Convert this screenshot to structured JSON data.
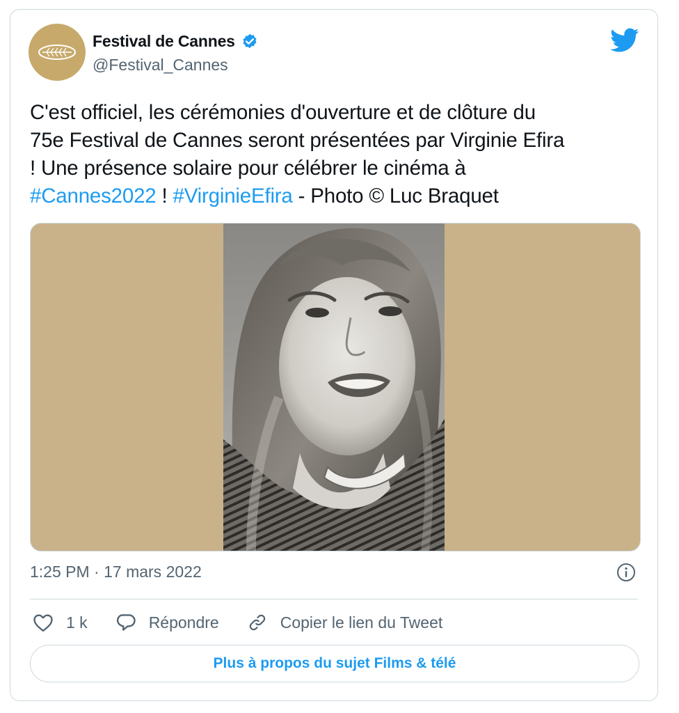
{
  "tweet": {
    "author": {
      "display_name": "Festival de Cannes",
      "handle": "@Festival_Cannes",
      "verified": true,
      "avatar_icon": "palm-leaf-icon"
    },
    "text": {
      "line1": "C'est officiel, les cérémonies d'ouverture et de clôture du",
      "line2": "75e Festival de Cannes seront présentées par Virginie Efira",
      "line3": "! Une présence solaire pour célébrer le cinéma à",
      "hashtag1": "#Cannes2022",
      "sep1": " ! ",
      "hashtag2": "#VirginieEfira",
      "tail": " - Photo © Luc Braquet"
    },
    "media": {
      "background_color": "#c9b28a",
      "photo_style": "black-and-white portrait"
    },
    "timestamp": "1:25 PM · 17 mars 2022",
    "actions": {
      "like_count": "1 k",
      "reply_label": "Répondre",
      "copy_link_label": "Copier le lien du Tweet"
    },
    "more_button_label": "Plus à propos du sujet Films & télé"
  },
  "colors": {
    "accent": "#1d9bf0",
    "text": "#0f1419",
    "secondary": "#536471",
    "border": "#cfd9de",
    "gold": "#c7a96b"
  }
}
